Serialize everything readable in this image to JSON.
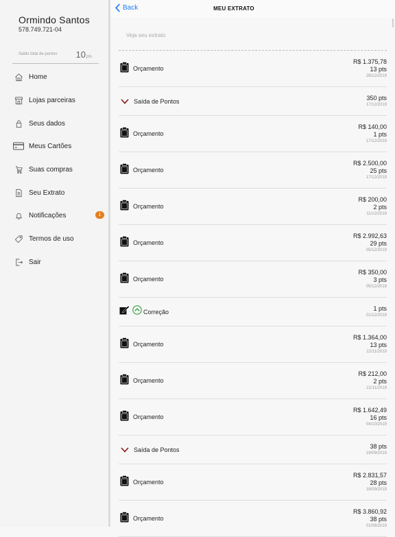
{
  "sidebar": {
    "user_name": "Ormindo Santos",
    "user_cpf": "578.749.721-04",
    "points_label": "Saldo total de pontos",
    "points_value": "10",
    "points_unit": "pts",
    "items": [
      {
        "label": "Home",
        "icon": "home-icon"
      },
      {
        "label": "Lojas parceiras",
        "icon": "store-icon"
      },
      {
        "label": "Seus dados",
        "icon": "lock-icon"
      },
      {
        "label": "Meus Cartões",
        "icon": "credit-card-icon"
      },
      {
        "label": "Suas compras",
        "icon": "cart-icon"
      },
      {
        "label": "Seu Extrato",
        "icon": "document-icon"
      },
      {
        "label": "Notificações",
        "icon": "bell-icon",
        "badge": "1"
      },
      {
        "label": "Termos de uso",
        "icon": "tag-icon"
      },
      {
        "label": "Sair",
        "icon": "logout-icon"
      }
    ]
  },
  "header": {
    "back_label": "Back",
    "title": "MEU EXTRATO"
  },
  "subtitle": "Veja seu extrato",
  "colors": {
    "accent": "#1e7cf2",
    "badge": "#e67e22",
    "down_arrow": "#8b1a1a",
    "up_arrow": "#2e9e3a"
  },
  "transactions": [
    {
      "type": "orcamento",
      "label": "Orçamento",
      "amount": "R$ 1.375,78",
      "points": "13 pts",
      "date": "28/12/2019"
    },
    {
      "type": "saida",
      "label": "Saída de Pontos",
      "amount": "",
      "points": "350 pts",
      "date": "17/12/2019"
    },
    {
      "type": "orcamento",
      "label": "Orçamento",
      "amount": "R$ 140,00",
      "points": "1 pts",
      "date": "17/12/2019"
    },
    {
      "type": "orcamento",
      "label": "Orçamento",
      "amount": "R$ 2.500,00",
      "points": "25 pts",
      "date": "17/12/2019"
    },
    {
      "type": "orcamento",
      "label": "Orçamento",
      "amount": "R$ 200,00",
      "points": "2 pts",
      "date": "11/12/2019"
    },
    {
      "type": "orcamento",
      "label": "Orçamento",
      "amount": "R$ 2.992,63",
      "points": "29 pts",
      "date": "05/12/2019"
    },
    {
      "type": "orcamento",
      "label": "Orçamento",
      "amount": "R$ 350,00",
      "points": "3 pts",
      "date": "05/12/2019"
    },
    {
      "type": "correcao",
      "label": "Correção",
      "amount": "",
      "points": "1 pts",
      "date": "01/12/2019"
    },
    {
      "type": "orcamento",
      "label": "Orçamento",
      "amount": "R$ 1.364,00",
      "points": "13 pts",
      "date": "22/11/2019"
    },
    {
      "type": "orcamento",
      "label": "Orçamento",
      "amount": "R$ 212,00",
      "points": "2 pts",
      "date": "21/11/2019"
    },
    {
      "type": "orcamento",
      "label": "Orçamento",
      "amount": "R$ 1.642,49",
      "points": "16 pts",
      "date": "04/10/2019"
    },
    {
      "type": "saida",
      "label": "Saída de Pontos",
      "amount": "",
      "points": "38 pts",
      "date": "19/09/2019"
    },
    {
      "type": "orcamento",
      "label": "Orçamento",
      "amount": "R$ 2.831,57",
      "points": "28 pts",
      "date": "18/09/2019"
    },
    {
      "type": "orcamento",
      "label": "Orçamento",
      "amount": "R$ 3.860,92",
      "points": "38 pts",
      "date": "01/08/2019"
    }
  ]
}
